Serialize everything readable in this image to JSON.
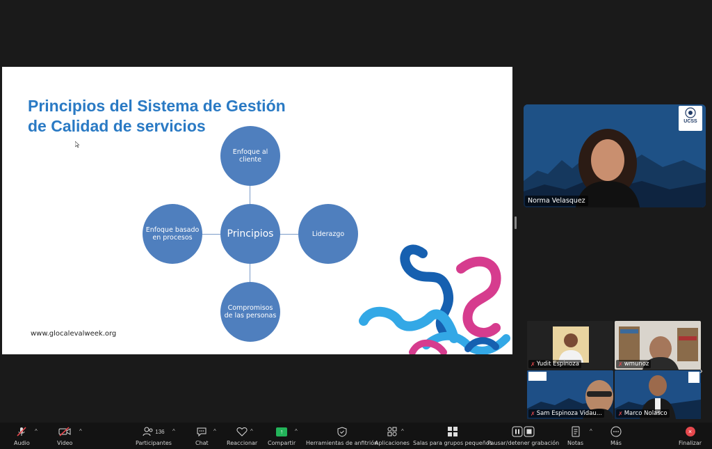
{
  "slide": {
    "title_line1": "Principios del Sistema de Gestión",
    "title_line2": "de Calidad de servicios",
    "url": "www.glocalevalweek.org",
    "diagram": {
      "center": "Principios",
      "top": "Enfoque al cliente",
      "left": "Enfoque basado en procesos",
      "right": "Liderazgo",
      "bottom": "Compromisos de las personas"
    }
  },
  "speaker": {
    "name": "Norma Velasquez",
    "logo_text": "UCSS"
  },
  "gallery": [
    {
      "name": "Yudit Espinoza"
    },
    {
      "name": "wmunoz"
    },
    {
      "name": "Sam Espinoza Vidau..."
    },
    {
      "name": "Marco Nolasco"
    }
  ],
  "toolbar": {
    "audio": "Audio",
    "video": "Video",
    "participants": "Participantes",
    "participants_count": "136",
    "chat": "Chat",
    "react": "Reaccionar",
    "share": "Compartir",
    "host_tools": "Herramientas de anfitrión",
    "apps": "Aplicaciones",
    "breakout": "Salas para grupos pequeños",
    "record": "Pausar/detener grabación",
    "notes": "Notas",
    "more": "Más",
    "end": "Finalizar"
  },
  "colors": {
    "accent_title": "#2a7ac4",
    "circle": "#4f7fbe",
    "share_green": "#23b45a",
    "end_red": "#e5484d"
  }
}
